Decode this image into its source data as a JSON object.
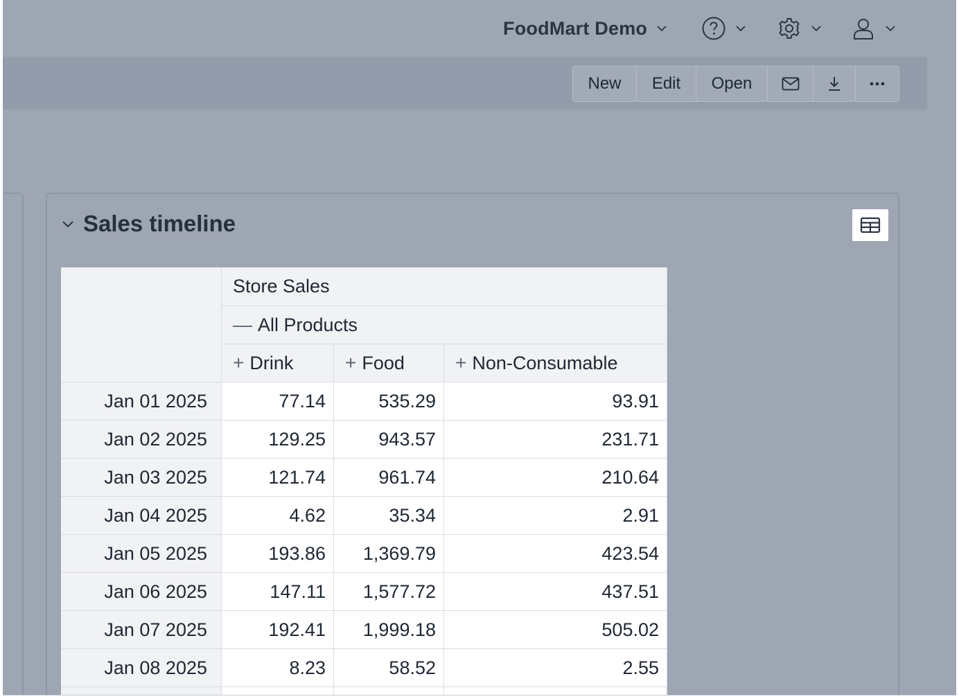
{
  "header": {
    "app_name": "FoodMart Demo",
    "icons": [
      "chevron-down-icon",
      "help-icon",
      "gear-icon",
      "user-icon"
    ]
  },
  "toolbar": {
    "new_label": "New",
    "edit_label": "Edit",
    "open_label": "Open",
    "email_icon": "mail-icon",
    "download_icon": "download-icon",
    "more_icon": "more-icon"
  },
  "widget": {
    "title": "Sales timeline",
    "view_toggle_icon": "table-icon"
  },
  "pivot": {
    "measure": "Store Sales",
    "level_label": "All Products",
    "level_toggle": "—",
    "expand_toggle": "+",
    "columns": [
      "Drink",
      "Food",
      "Non-Consumable"
    ],
    "rows": [
      {
        "label": "Jan 01 2025",
        "values": [
          "77.14",
          "535.29",
          "93.91"
        ]
      },
      {
        "label": "Jan 02 2025",
        "values": [
          "129.25",
          "943.57",
          "231.71"
        ]
      },
      {
        "label": "Jan 03 2025",
        "values": [
          "121.74",
          "961.74",
          "210.64"
        ]
      },
      {
        "label": "Jan 04 2025",
        "values": [
          "4.62",
          "35.34",
          "2.91"
        ]
      },
      {
        "label": "Jan 05 2025",
        "values": [
          "193.86",
          "1,369.79",
          "423.54"
        ]
      },
      {
        "label": "Jan 06 2025",
        "values": [
          "147.11",
          "1,577.72",
          "437.51"
        ]
      },
      {
        "label": "Jan 07 2025",
        "values": [
          "192.41",
          "1,999.18",
          "505.02"
        ]
      },
      {
        "label": "Jan 08 2025",
        "values": [
          "8.23",
          "58.52",
          "2.55"
        ]
      }
    ]
  },
  "colors": {
    "overlay": "#9ea5b3",
    "toolbar_band": "#939cab",
    "header_cell": "#f1f2f4",
    "grid_line": "#d9dce1"
  }
}
